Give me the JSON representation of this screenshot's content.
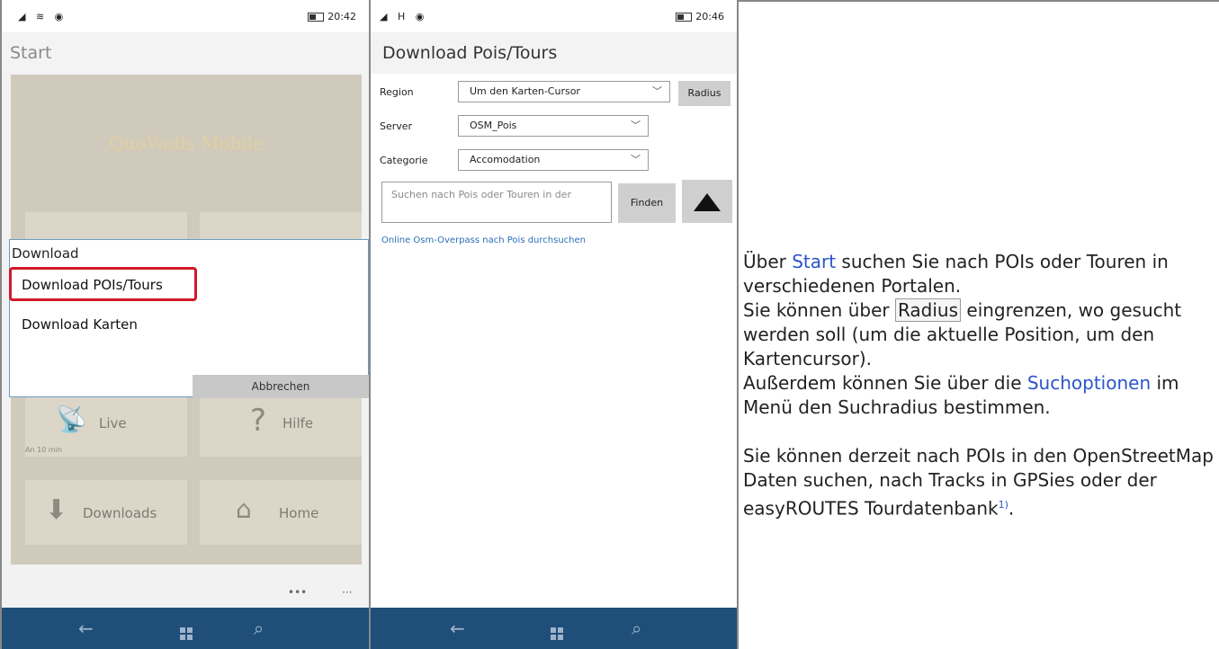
{
  "phone1": {
    "status": {
      "signal": "◢ ≋ ◉",
      "time": "20:42"
    },
    "title": "Start",
    "app_name": "QuoVadis Mobile",
    "dialog": {
      "title": "Download",
      "items": [
        "Download POIs/Tours",
        "Download Karten"
      ],
      "cancel": "Abbrechen"
    },
    "tiles": {
      "live": "Live",
      "live_sub": "An 10 min",
      "help": "Hilfe",
      "downloads": "Downloads",
      "home": "Home"
    },
    "more": "•••",
    "more2": "···"
  },
  "phone2": {
    "status": {
      "signal": "◢ H ◉",
      "time": "20:46"
    },
    "title": "Download Pois/Tours",
    "region_label": "Region",
    "region_value": "Um den Karten-Cursor",
    "radius_button": "Radius",
    "server_label": "Server",
    "server_value": "OSM_Pois",
    "category_label": "Categorie",
    "category_value": "Accomodation",
    "search_placeholder": "Suchen nach Pois oder Touren in der",
    "find_button": "Finden",
    "link": "Online Osm-Overpass nach Pois durchsuchen"
  },
  "navbar": {
    "back": "←",
    "search": "⌕"
  },
  "text": {
    "p1_prefix": "Über ",
    "p1_link": "Start",
    "p1_rest": " suchen Sie nach POIs oder Touren in verschiedenen Portalen.",
    "p2_prefix": "Sie können über ",
    "p2_key": "Radius",
    "p2_rest": " eingrenzen, wo gesucht werden soll (um die aktuelle Position, um den Kartencursor).",
    "p3_prefix": "Außerdem können Sie über die ",
    "p3_link": "Suchoptionen",
    "p3_rest": " im Menü den Suchradius bestimmen.",
    "p4": "Sie können derzeit nach POIs in den OpenStreetMap Daten suchen, nach Tracks in GPSies oder der easyROUTES Tourdatenbank",
    "footnote": "1)",
    "p4_end": "."
  }
}
